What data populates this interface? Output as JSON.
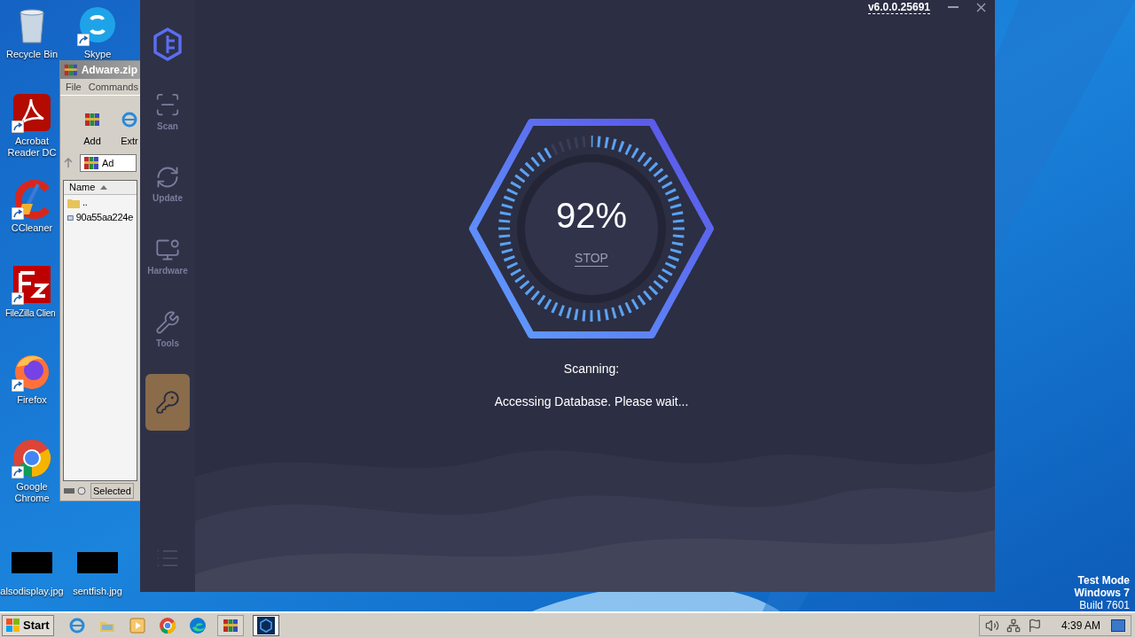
{
  "desktop": {
    "icons": [
      {
        "kind": "trash",
        "label": "Recycle Bin"
      },
      {
        "kind": "skype",
        "label": "Skype"
      },
      {
        "kind": "acrobat",
        "label": "Acrobat Reader DC"
      },
      {
        "kind": "ccleaner",
        "label": "CCleaner"
      },
      {
        "kind": "filezilla",
        "label": "FileZilla Clien"
      },
      {
        "kind": "firefox",
        "label": "Firefox"
      },
      {
        "kind": "chrome",
        "label": "Google Chrome"
      },
      {
        "kind": "image",
        "label": "alsodisplay.jpg"
      },
      {
        "kind": "image",
        "label": "sentfish.jpg"
      }
    ],
    "system_text": [
      "Test Mode",
      "Windows 7",
      "Build 7601"
    ]
  },
  "archive_window": {
    "title": "Adware.zip",
    "menu": [
      "File",
      "Commands"
    ],
    "toolbar": [
      "Add",
      "Extr"
    ],
    "address": "Ad",
    "column": "Name",
    "rows": [
      {
        "kind": "folder",
        "name": ".."
      },
      {
        "kind": "file",
        "name": "90a55aa224e"
      }
    ],
    "status": "Selected"
  },
  "app": {
    "version": "v6.0.0.25691",
    "nav": [
      {
        "kind": "scan",
        "label": "Scan",
        "selected": false
      },
      {
        "kind": "update",
        "label": "Update",
        "selected": false
      },
      {
        "kind": "hardware",
        "label": "Hardware",
        "selected": false
      },
      {
        "kind": "tools",
        "label": "Tools",
        "selected": false
      },
      {
        "kind": "key",
        "selected": true
      }
    ],
    "scan": {
      "level": 0.92,
      "percent": "92%",
      "stop": "STOP",
      "status": "Scanning:",
      "detail": "Accessing Database. Please wait..."
    }
  },
  "taskbar": {
    "start": "Start",
    "apps": [
      {
        "kind": "ie",
        "selected": false
      },
      {
        "kind": "explorer",
        "selected": false
      },
      {
        "kind": "media",
        "selected": false
      },
      {
        "kind": "chrome",
        "selected": false
      },
      {
        "kind": "edge",
        "selected": false
      },
      {
        "kind": "winrar",
        "selected": false
      },
      {
        "kind": "app",
        "selected": true
      }
    ],
    "clock": "4:39 AM"
  }
}
